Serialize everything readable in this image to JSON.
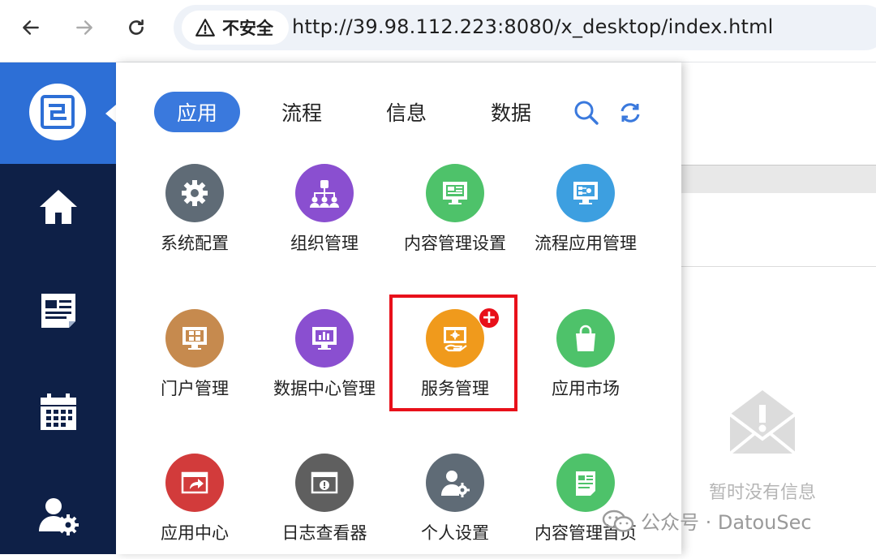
{
  "browser": {
    "security_label": "不安全",
    "url": "http://39.98.112.223:8080/x_desktop/index.html"
  },
  "sidebar": {
    "items": [
      {
        "icon": "home-icon"
      },
      {
        "icon": "news-icon"
      },
      {
        "icon": "calendar-icon"
      },
      {
        "icon": "user-settings-icon"
      }
    ]
  },
  "tabs": [
    {
      "label": "应用",
      "active": true
    },
    {
      "label": "流程",
      "active": false
    },
    {
      "label": "信息",
      "active": false
    },
    {
      "label": "数据",
      "active": false
    }
  ],
  "apps": [
    {
      "label": "系统配置",
      "icon": "gear-icon",
      "color": "#5f6b76"
    },
    {
      "label": "组织管理",
      "icon": "org-chart-icon",
      "color": "#8a4fd0"
    },
    {
      "label": "内容管理设置",
      "icon": "monitor-content-icon",
      "color": "#4ec26a"
    },
    {
      "label": "流程应用管理",
      "icon": "monitor-flow-icon",
      "color": "#3d9fe0"
    },
    {
      "label": "门户管理",
      "icon": "monitor-grid-icon",
      "color": "#c68a4e"
    },
    {
      "label": "数据中心管理",
      "icon": "monitor-chart-icon",
      "color": "#8a4fd0"
    },
    {
      "label": "服务管理",
      "icon": "service-icon",
      "color": "#f09a1c",
      "highlighted": true,
      "badge": "+"
    },
    {
      "label": "应用市场",
      "icon": "shopping-bag-icon",
      "color": "#4ec26a"
    },
    {
      "label": "应用中心",
      "icon": "window-share-icon",
      "color": "#d23b3b"
    },
    {
      "label": "日志查看器",
      "icon": "window-alert-icon",
      "color": "#5f5f5f"
    },
    {
      "label": "个人设置",
      "icon": "user-gear-icon",
      "color": "#5f6b76"
    },
    {
      "label": "内容管理首页",
      "icon": "news-icon",
      "color": "#4ec26a"
    }
  ],
  "empty_state": {
    "text": "暂时没有信息",
    "icon": "envelope-alert-icon"
  },
  "watermark": {
    "text": "公众号 · DatouSec"
  },
  "colors": {
    "accent": "#3a79dd",
    "sidebar_bg": "#0e2047",
    "highlight": "#e8101a"
  }
}
